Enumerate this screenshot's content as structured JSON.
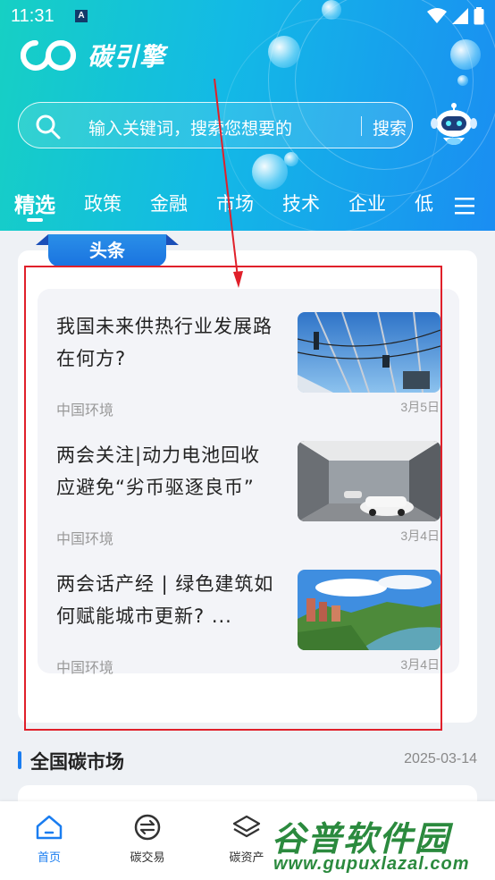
{
  "status_bar": {
    "time": "11:31",
    "notification_badge": "A"
  },
  "app": {
    "name": "碳引擎"
  },
  "search": {
    "placeholder": "输入关键词，搜索您想要的",
    "button": "搜索"
  },
  "tabs": [
    {
      "label": "精选",
      "active": true
    },
    {
      "label": "政策"
    },
    {
      "label": "金融"
    },
    {
      "label": "市场"
    },
    {
      "label": "技术"
    },
    {
      "label": "企业"
    },
    {
      "label": "低"
    }
  ],
  "headline": {
    "ribbon": "头条",
    "items": [
      {
        "title": "我国未来供热行业发展路在何方?",
        "source": "中国环境",
        "date": "3月5日",
        "thumb": "power-lines-photo"
      },
      {
        "title": "两会关注|动力电池回收应避免“劣币驱逐良币”",
        "source": "中国环境",
        "date": "3月4日",
        "thumb": "car-factory-photo"
      },
      {
        "title": "两会话产经 | 绿色建筑如何赋能城市更新? ...",
        "source": "中国环境",
        "date": "3月4日",
        "thumb": "city-river-photo"
      }
    ]
  },
  "section": {
    "title": "全国碳市场",
    "date": "2025-03-14"
  },
  "bottom_nav": [
    {
      "label": "首页",
      "icon": "home-icon",
      "active": true
    },
    {
      "label": "碳交易",
      "icon": "exchange-icon"
    },
    {
      "label": "碳资产",
      "icon": "layers-icon"
    }
  ],
  "watermark": {
    "title": "谷普软件园",
    "url": "www.gupuxlazal.com"
  },
  "colors": {
    "accent": "#1a7df0",
    "highlight_box": "#e0202a"
  }
}
